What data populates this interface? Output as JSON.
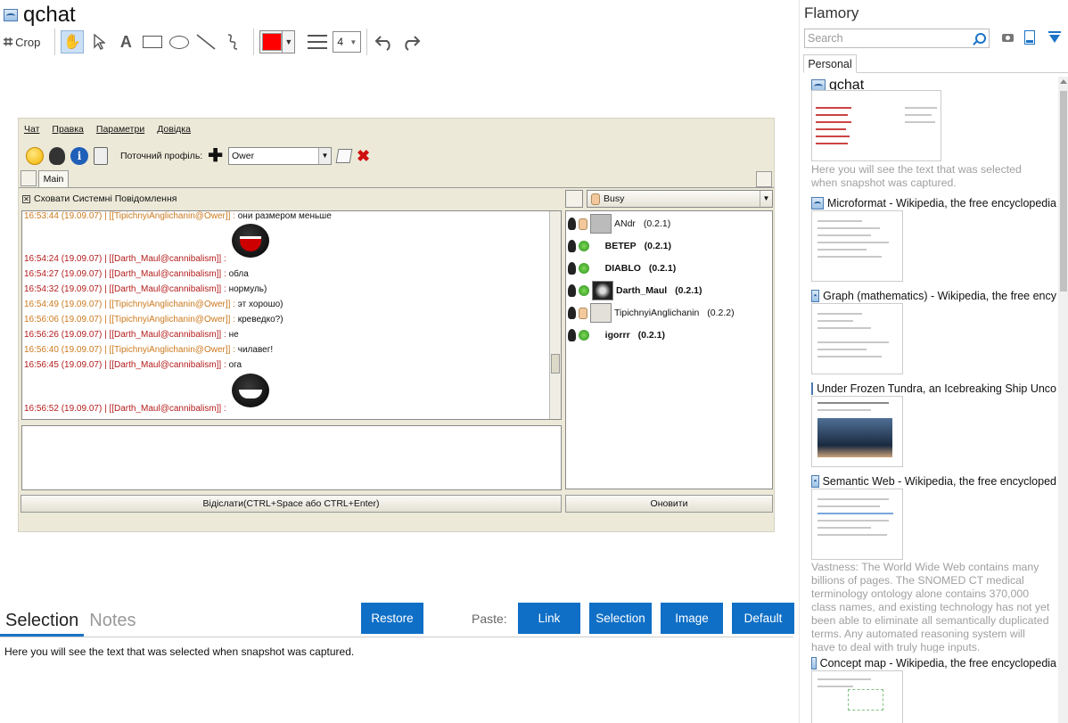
{
  "snapshot": {
    "title": "qchat"
  },
  "toolbar": {
    "crop_label": "Crop",
    "line_width": "4",
    "color": "#ff0000"
  },
  "qchat": {
    "menu": [
      "Чат",
      "Правка",
      "Параметри",
      "Довідка"
    ],
    "profile_label": "Поточний профіль:",
    "profile_value": "Ower",
    "tab_main": "Main",
    "hide_system": "Сховати Системні Повідомлення",
    "messages": [
      {
        "time": "16:53:44 (19.09.07)",
        "who": "[[TipichnyiAnglichanin@Ower]]",
        "kind": "t",
        "text": "они размером меньше"
      },
      {
        "time": "16:54:24 (19.09.07)",
        "who": "[[Darth_Maul@cannibalism]]",
        "kind": "d",
        "text": ""
      },
      {
        "time": "16:54:27 (19.09.07)",
        "who": "[[Darth_Maul@cannibalism]]",
        "kind": "d",
        "text": "обла"
      },
      {
        "time": "16:54:32 (19.09.07)",
        "who": "[[Darth_Maul@cannibalism]]",
        "kind": "d",
        "text": "нормуль)"
      },
      {
        "time": "16:54:49 (19.09.07)",
        "who": "[[TipichnyiAnglichanin@Ower]]",
        "kind": "t",
        "text": "эт хорошо)"
      },
      {
        "time": "16:56:06 (19.09.07)",
        "who": "[[TipichnyiAnglichanin@Ower]]",
        "kind": "t",
        "text": "креведко?)"
      },
      {
        "time": "16:56:26 (19.09.07)",
        "who": "[[Darth_Maul@cannibalism]]",
        "kind": "d",
        "text": "не"
      },
      {
        "time": "16:56:40 (19.09.07)",
        "who": "[[TipichnyiAnglichanin@Ower]]",
        "kind": "t",
        "text": "чилавег!"
      },
      {
        "time": "16:56:45 (19.09.07)",
        "who": "[[Darth_Maul@cannibalism]]",
        "kind": "d",
        "text": "ога"
      },
      {
        "time": "16:56:52 (19.09.07)",
        "who": "[[Darth_Maul@cannibalism]]",
        "kind": "d",
        "text": ""
      }
    ],
    "send_label": "Відіслати(CTRL+Space або CTRL+Enter)",
    "status": "Busy",
    "roster": [
      {
        "name": "ANdr",
        "ver": "(0.2.1)",
        "bold": false,
        "avatar": "grey"
      },
      {
        "name": "ВЕТЕР",
        "ver": "(0.2.1)",
        "bold": true,
        "avatar": ""
      },
      {
        "name": "DIABLO",
        "ver": "(0.2.1)",
        "bold": true,
        "avatar": ""
      },
      {
        "name": "Darth_Maul",
        "ver": "(0.2.1)",
        "bold": true,
        "avatar": "dark"
      },
      {
        "name": "TipichnyiAnglichanin",
        "ver": "(0.2.2)",
        "bold": false,
        "avatar": "light"
      },
      {
        "name": "igorrr",
        "ver": "(0.2.1)",
        "bold": true,
        "avatar": ""
      }
    ],
    "refresh_label": "Оновити"
  },
  "bottom": {
    "tab_selection": "Selection",
    "tab_notes": "Notes",
    "restore": "Restore",
    "paste_label": "Paste:",
    "paste_link": "Link",
    "paste_selection": "Selection",
    "paste_image": "Image",
    "paste_default": "Default",
    "selection_text": "Here you will see the text that was selected when snapshot was captured."
  },
  "library": {
    "title": "Flamory",
    "search_placeholder": "Search",
    "tab_personal": "Personal",
    "items": [
      {
        "title": "qchat",
        "desc": "Here you will see the text that was selected when snapshot was captured."
      },
      {
        "title": "Microformat - Wikipedia, the free encyclopedia",
        "desc": ""
      },
      {
        "title": "Graph (mathematics) - Wikipedia, the free ency",
        "desc": ""
      },
      {
        "title": "Under Frozen Tundra, an Icebreaking Ship Unco",
        "desc": ""
      },
      {
        "title": "Semantic Web - Wikipedia, the free encycloped",
        "desc": "Vastness: The World Wide Web contains many billions of pages. The SNOMED CT medical terminology ontology alone contains 370,000 class names, and existing technology has not yet been able to eliminate all semantically duplicated terms. Any automated reasoning system will have to deal with truly huge inputs."
      },
      {
        "title": "Concept map - Wikipedia, the free encyclopedia",
        "desc": ""
      }
    ]
  }
}
